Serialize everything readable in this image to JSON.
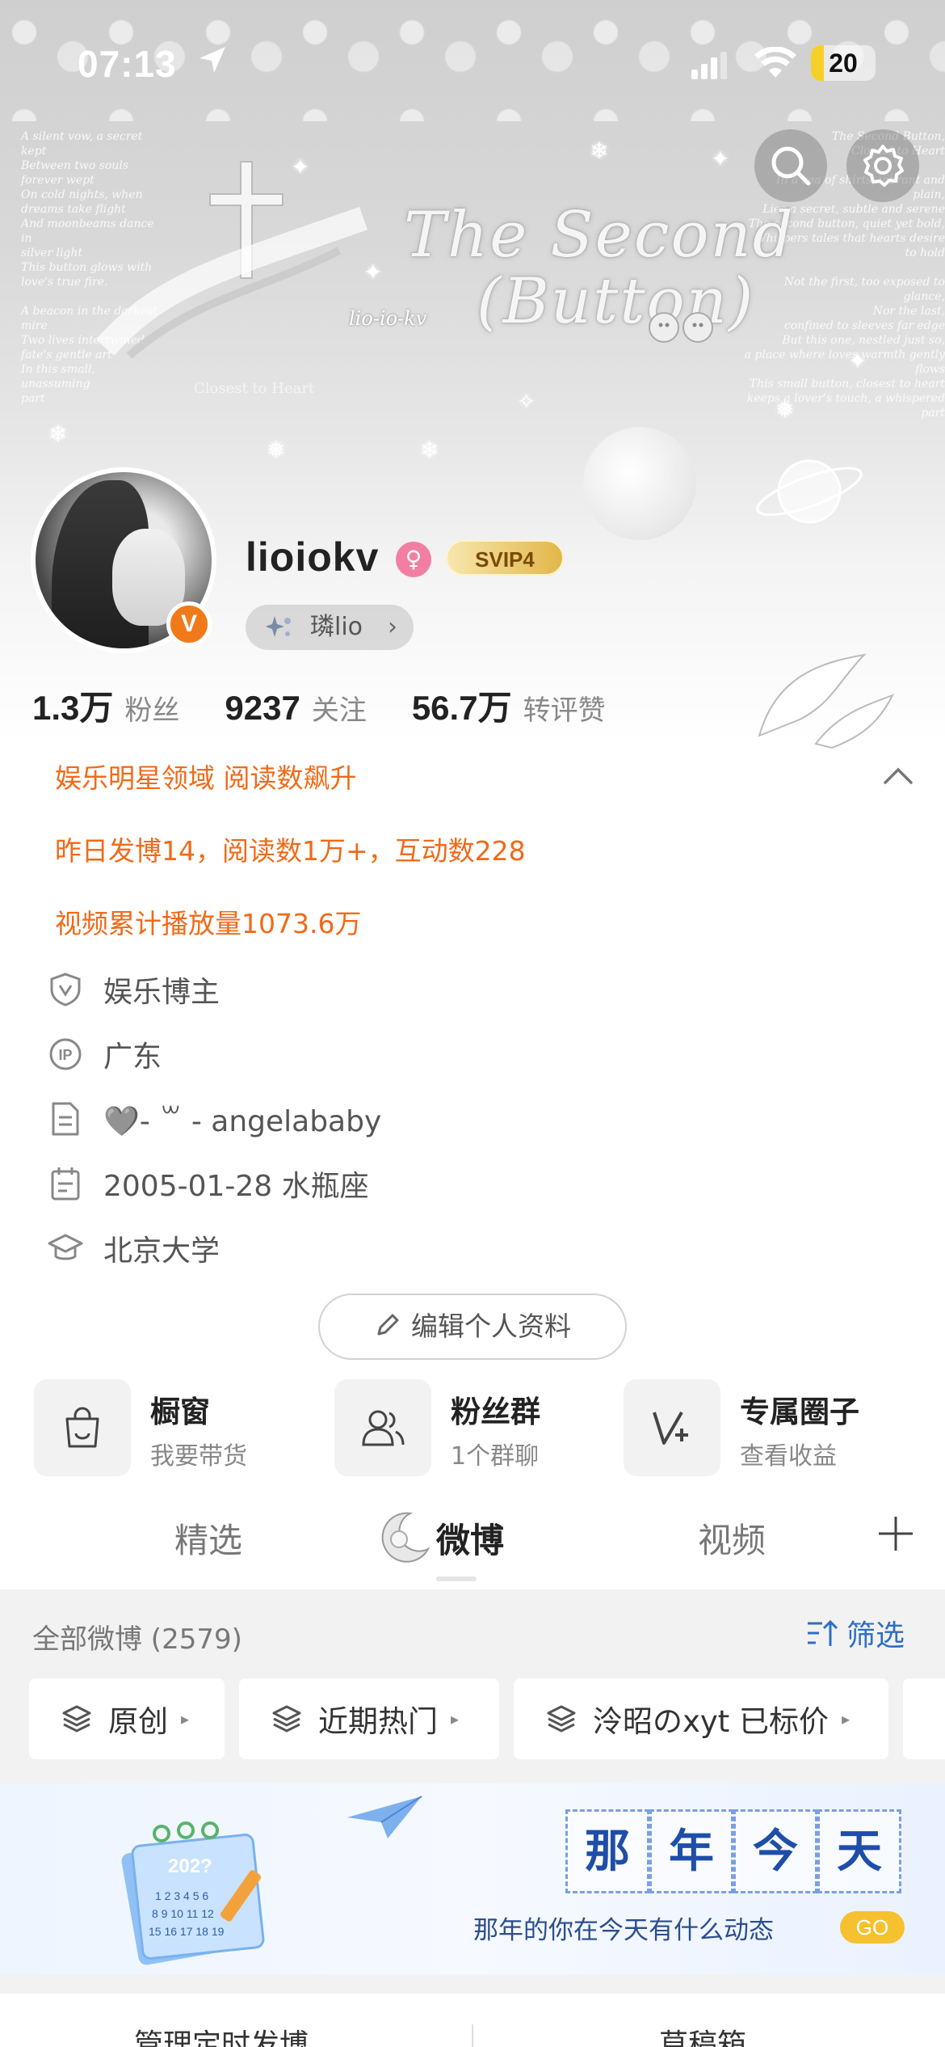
{
  "status_bar": {
    "time": "07:13",
    "battery": "20",
    "battery_fraction": 0.2,
    "battery_color": "#f6d02a"
  },
  "cover": {
    "title_line1": "The Second",
    "title_line2": "Button",
    "signature": "lio-io-kv",
    "caption": "Closest to Heart"
  },
  "profile": {
    "username": "lioiokv",
    "vip_badge": "SVIP4",
    "tag_label": "璘lio",
    "verified_icon": "v-badge",
    "accent": "#f07a19"
  },
  "stats": [
    {
      "value": "1.3万",
      "label": "粉丝"
    },
    {
      "value": "9237",
      "label": "关注"
    },
    {
      "value": "56.7万",
      "label": "转评赞"
    }
  ],
  "achievements": [
    "娱乐明星领域 阅读数飙升",
    "昨日发博14，阅读数1万+，互动数228",
    "视频累计播放量1073.6万"
  ],
  "info": {
    "category": "娱乐博主",
    "ip": "广东",
    "bio": "🩶- ꒳ - angelababy",
    "birthday": "2005-01-28 水瓶座",
    "school": "北京大学"
  },
  "edit_button": "编辑个人资料",
  "quick_entries": [
    {
      "title": "橱窗",
      "subtitle": "我要带货",
      "icon": "shopping-bag-icon"
    },
    {
      "title": "粉丝群",
      "subtitle": "1个群聊",
      "icon": "group-icon"
    },
    {
      "title": "专属圈子",
      "subtitle": "查看收益",
      "icon": "v-plus-icon"
    }
  ],
  "tabs": {
    "featured": "精选",
    "weibo": "微博",
    "video": "视频"
  },
  "feed": {
    "count_label": "全部微博 (2579)",
    "filter_label": "筛选",
    "link_color": "#2d6fc4",
    "chips": [
      "原创",
      "近期热门",
      "泠昭のxyt 已标价"
    ]
  },
  "banner": {
    "stamp_chars": [
      "那",
      "年",
      "今",
      "天"
    ],
    "subtitle": "那年的你在今天有什么动态",
    "go_label": "GO",
    "calendar_year": "202?"
  },
  "bottom": {
    "left": "管理定时发博",
    "right": "草稿箱"
  }
}
